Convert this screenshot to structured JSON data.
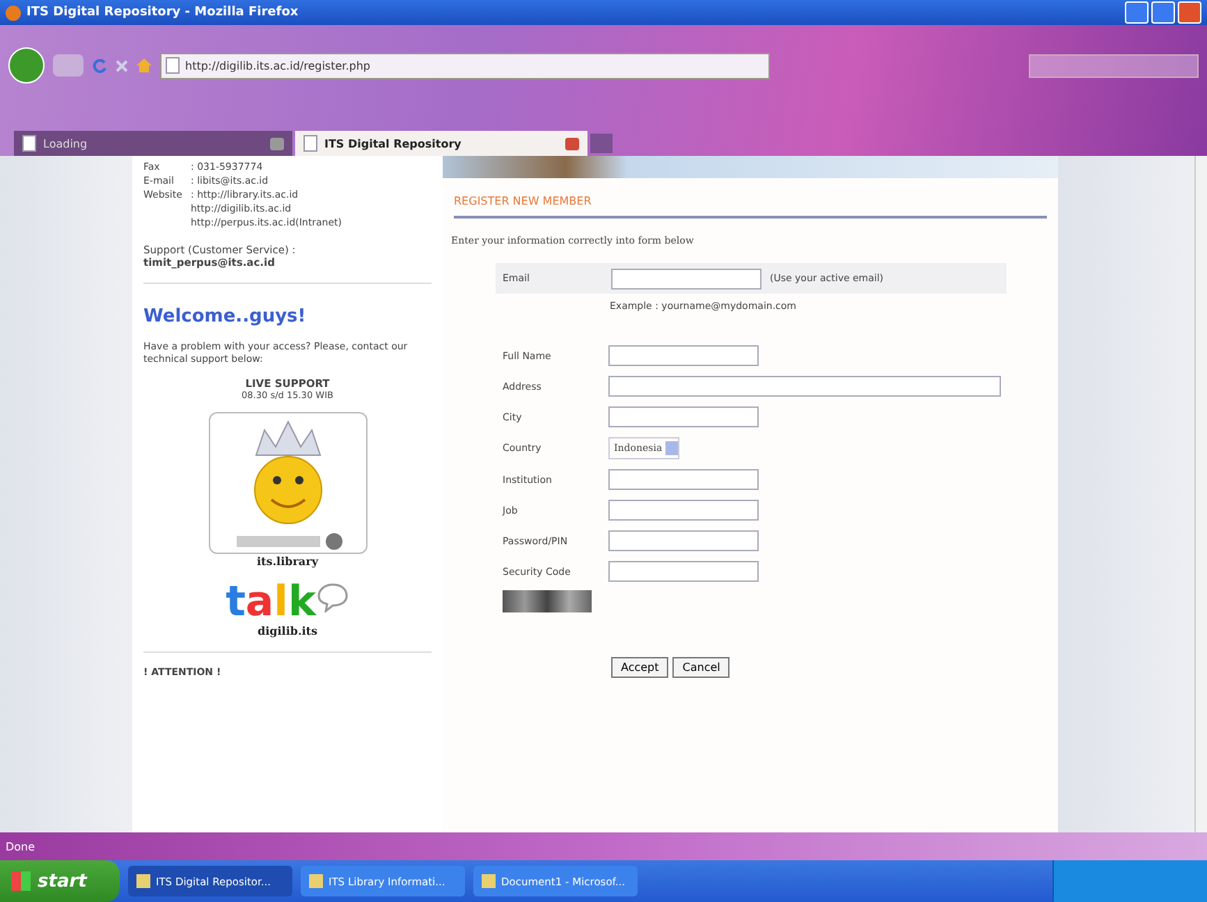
{
  "window": {
    "title": "ITS Digital Repository - Mozilla Firefox"
  },
  "address_bar": {
    "value": "http://digilib.its.ac.id/register.php"
  },
  "tabs": [
    {
      "label": "Loading",
      "selected": false
    },
    {
      "label": "ITS Digital Repository",
      "selected": true
    }
  ],
  "sidebar": {
    "contact": [
      {
        "label": "Fax",
        "value": ": 031-5937774"
      },
      {
        "label": "E-mail",
        "value": ": libits@its.ac.id"
      },
      {
        "label": "Website",
        "value": ": http://library.its.ac.id"
      },
      {
        "value": "http://digilib.its.ac.id"
      },
      {
        "value": "http://perpus.its.ac.id(Intranet)"
      }
    ],
    "support_label": "Support (Customer Service) :",
    "support_email": "timit_perpus@its.ac.id",
    "welcome": "Welcome..guys!",
    "help_text": "Have a problem with your access? Please, contact our technical support below:",
    "live_support": "LIVE SUPPORT",
    "hours": "08.30 s/d 15.30 WIB",
    "yahoo_id": "its.library",
    "talk_logo": "talk",
    "talk_id": "digilib.its",
    "attention": "! ATTENTION !"
  },
  "form": {
    "heading": "REGISTER NEW MEMBER",
    "intro": "Enter your information correctly into form below",
    "email": {
      "label": "Email",
      "hint": "(Use your active email)",
      "example": "Example : yourname@mydomain.com"
    },
    "fields": [
      {
        "label": "Full Name",
        "kind": "text"
      },
      {
        "label": "Address",
        "kind": "wide"
      },
      {
        "label": "City",
        "kind": "text"
      },
      {
        "label": "Country",
        "kind": "select",
        "value": "Indonesia"
      },
      {
        "label": "Institution",
        "kind": "text"
      },
      {
        "label": "Job",
        "kind": "text"
      },
      {
        "label": "Password/PIN",
        "kind": "text"
      },
      {
        "label": "Security Code",
        "kind": "text"
      }
    ],
    "buttons": [
      "Accept",
      "Cancel"
    ]
  },
  "status_bar": {
    "text": "Done"
  },
  "taskbar": {
    "start": "start",
    "items": [
      {
        "label": "ITS Digital Repositor...",
        "selected": true
      },
      {
        "label": "ITS Library Informati...",
        "selected": false
      },
      {
        "label": "Document1 - Microsof...",
        "selected": false
      }
    ]
  }
}
